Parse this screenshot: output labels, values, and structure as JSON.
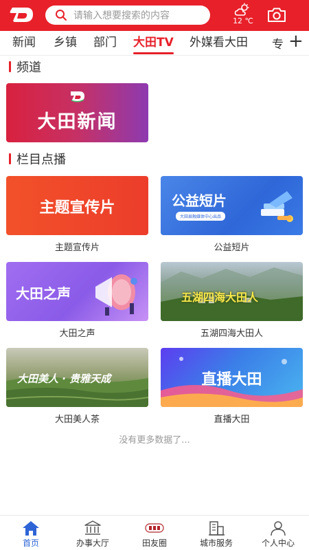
{
  "header": {
    "search_placeholder": "请输入想要搜索的内容",
    "temperature": "12 ℃"
  },
  "tabs": [
    {
      "label": "新闻",
      "active": false
    },
    {
      "label": "乡镇",
      "active": false
    },
    {
      "label": "部门",
      "active": false
    },
    {
      "label": "大田TV",
      "active": true
    },
    {
      "label": "外媒看大田",
      "active": false
    },
    {
      "label": "专",
      "active": false
    }
  ],
  "tab_add": "+",
  "sections": {
    "channel_title": "频道",
    "programs_title": "栏目点播"
  },
  "channel": {
    "card_text": "大田新闻"
  },
  "programs": [
    {
      "caption": "主题宣传片",
      "thumb_text": "主题宣传片"
    },
    {
      "caption": "公益短片",
      "thumb_text": "公益短片",
      "thumb_subtext": "大田县融媒体中心出品"
    },
    {
      "caption": "大田之声",
      "thumb_text": "大田之声"
    },
    {
      "caption": "五湖四海大田人",
      "thumb_text": "五湖四海大田人"
    },
    {
      "caption": "大田美人茶",
      "thumb_text": "大田美人 · 贵雅天成"
    },
    {
      "caption": "直播大田",
      "thumb_text": "直播大田"
    }
  ],
  "no_more": "没有更多数据了...",
  "bottom_nav": [
    {
      "label": "首页",
      "icon": "home-icon",
      "active": true
    },
    {
      "label": "办事大厅",
      "icon": "bank-icon",
      "active": false
    },
    {
      "label": "田友圈",
      "icon": "tianyouquan-logo-icon",
      "active": false
    },
    {
      "label": "城市服务",
      "icon": "city-building-icon",
      "active": false
    },
    {
      "label": "个人中心",
      "icon": "person-icon",
      "active": false
    }
  ],
  "colors": {
    "brand_red": "#e8202a",
    "nav_active_blue": "#2e64d6"
  }
}
